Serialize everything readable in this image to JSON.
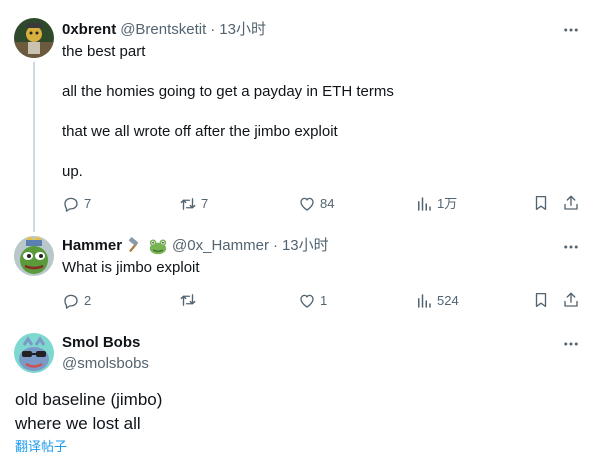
{
  "tweets": [
    {
      "name": "0xbrent",
      "handle": "@Brentsketit",
      "time": "13小时",
      "lines": [
        "the best part",
        "all the homies going to get a payday in ETH terms",
        "that we all wrote off after the jimbo exploit",
        "up."
      ],
      "replies": "7",
      "retweets": "7",
      "likes": "84",
      "views": "1万"
    },
    {
      "name": "Hammer",
      "handle": "@0x_Hammer",
      "time": "13小时",
      "lines": [
        "What is jimbo exploit"
      ],
      "replies": "2",
      "retweets": "",
      "likes": "1",
      "views": "524"
    }
  ],
  "main": {
    "name": "Smol Bobs",
    "handle": "@smolsbobs",
    "lines": [
      "old baseline (jimbo)",
      "where we lost all"
    ],
    "translate": "翻译帖子"
  },
  "separator": "·",
  "icons": [
    "more-icon",
    "reply-icon",
    "retweet-icon",
    "like-icon",
    "views-icon",
    "bookmark-icon",
    "share-icon",
    "hammer-emoji-icon",
    "frog-emoji-icon"
  ],
  "colors": {
    "text": "#0f1419",
    "secondary": "#536471",
    "link": "#1d9bf0",
    "thread": "#cfd9de"
  }
}
